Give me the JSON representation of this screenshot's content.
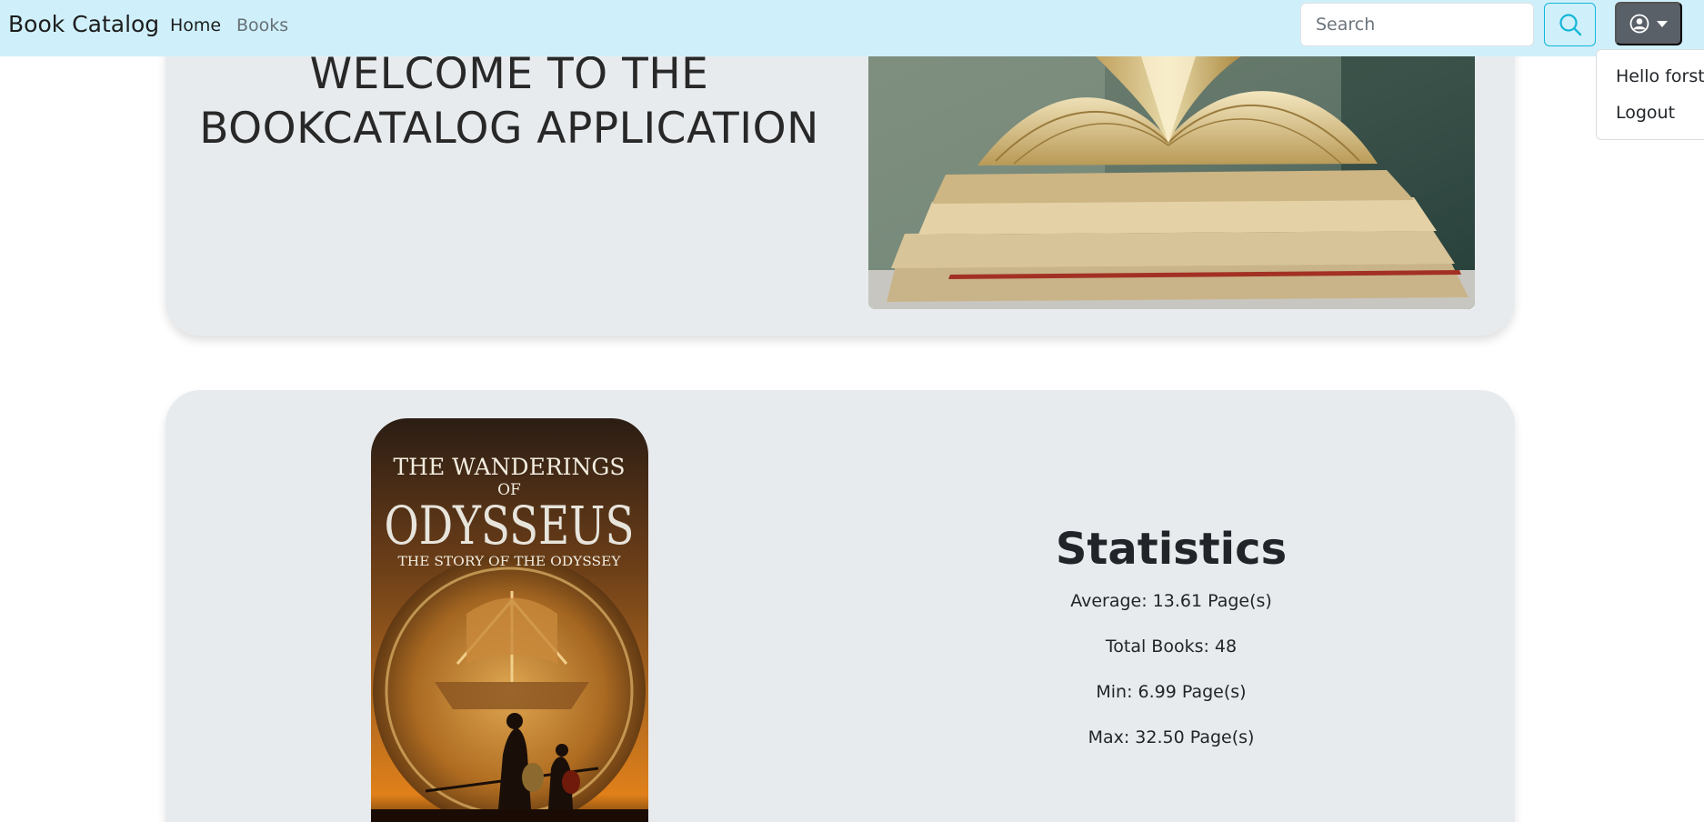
{
  "navbar": {
    "brand": "Book Catalog",
    "links": [
      {
        "label": "Home"
      },
      {
        "label": "Books"
      }
    ],
    "search": {
      "placeholder": "Search",
      "value": ""
    },
    "search_icon": "search-icon",
    "user_icon": "user-circle-icon",
    "user_menu": {
      "items": [
        {
          "label": "Hello forste"
        },
        {
          "label": "Logout"
        }
      ]
    }
  },
  "hero": {
    "title": "WELCOME TO THE BOOKCATALOG APPLICATION",
    "image": "stack-of-open-books"
  },
  "featured_book": {
    "cover_title_line1": "THE WANDERINGS",
    "cover_title_of": "OF",
    "cover_title_main": "ODYSSEUS",
    "cover_subtitle": "THE STORY OF THE ODYSSEY"
  },
  "statistics": {
    "title": "Statistics",
    "average": "Average: 13.61 Page(s)",
    "total": "Total Books: 48",
    "min": "Min: 6.99 Page(s)",
    "max": "Max: 32.50 Page(s)"
  },
  "colors": {
    "navbar_bg": "#cff0fb",
    "card_bg": "#e8ebee",
    "search_button_border": "#13b6d8",
    "user_button_bg": "#5a6068"
  }
}
